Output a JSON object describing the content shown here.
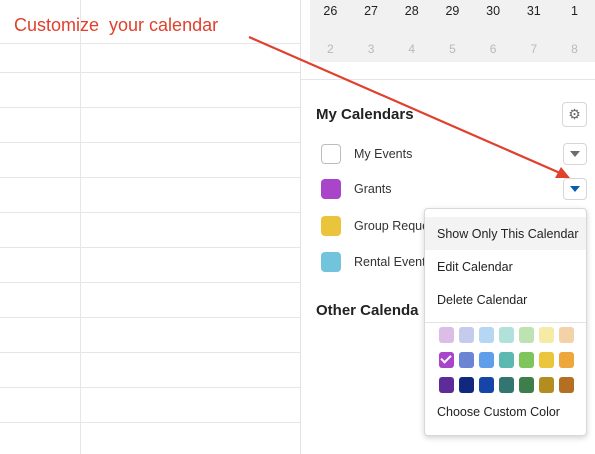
{
  "annotation": {
    "text": "Customize  your calendar",
    "color": "#e0402c"
  },
  "mini_calendar": {
    "row1": [
      "26",
      "27",
      "28",
      "29",
      "30",
      "31",
      "1"
    ],
    "row2": [
      "2",
      "3",
      "4",
      "5",
      "6",
      "7",
      "8"
    ]
  },
  "my_calendars": {
    "title": "My Calendars",
    "settings_icon": "gear-icon",
    "items": [
      {
        "label": "My Events",
        "color": ""
      },
      {
        "label": "Grants",
        "color": "#a845c8"
      },
      {
        "label": "Group Reque",
        "color": "#eac43b"
      },
      {
        "label": "Rental Event",
        "color": "#72c3dc"
      }
    ]
  },
  "other_calendars": {
    "title": "Other Calenda"
  },
  "menu": {
    "items": [
      "Show Only This Calendar",
      "Edit Calendar",
      "Delete Calendar"
    ],
    "custom_color": "Choose Custom Color",
    "selected_color": "#a845c8",
    "colors": [
      [
        "#dcbde8",
        "#c5cbed",
        "#b6d7f3",
        "#b2e1dc",
        "#bde3b3",
        "#f6eba6",
        "#f2d2a6"
      ],
      [
        "#a845c8",
        "#6b84d4",
        "#5f9ee8",
        "#5cb9b0",
        "#7fc55d",
        "#eac43b",
        "#eda73b"
      ],
      [
        "#5d2c98",
        "#10287e",
        "#1645a9",
        "#33766f",
        "#3d7e4b",
        "#b38d1f",
        "#b46f22"
      ]
    ]
  }
}
